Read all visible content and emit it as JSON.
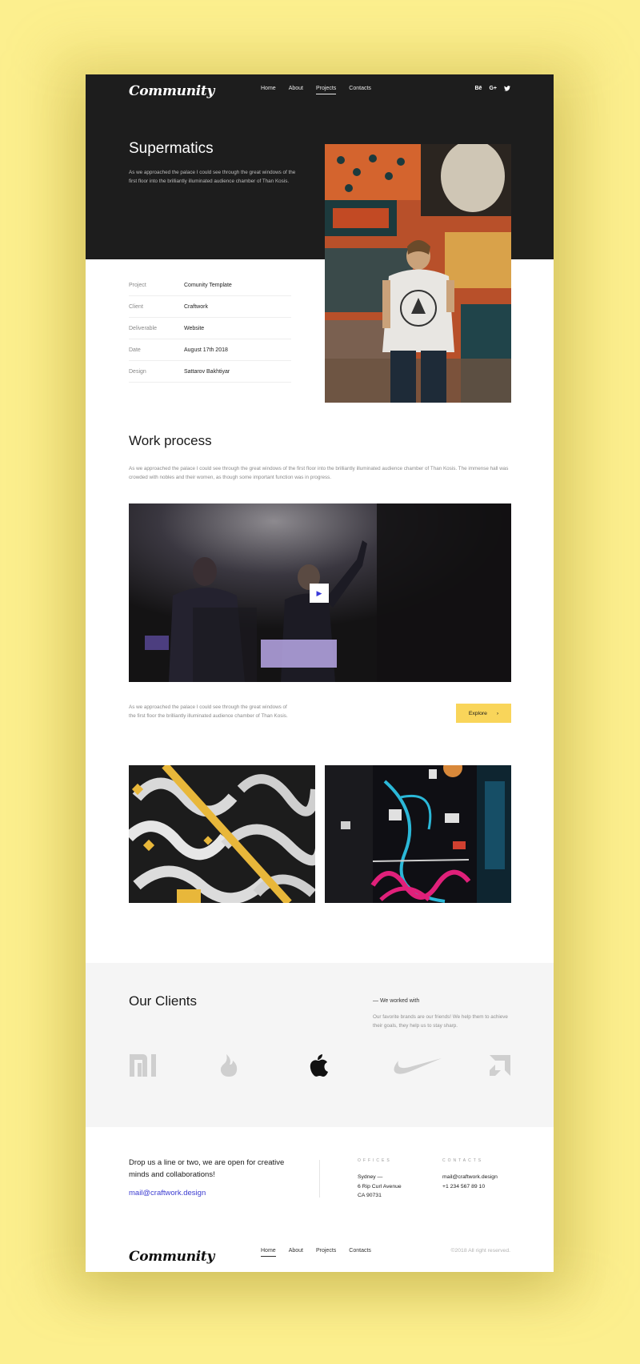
{
  "brand": {
    "logo": "Community"
  },
  "nav": {
    "items": [
      "Home",
      "About",
      "Projects",
      "Contacts"
    ],
    "active": "Projects"
  },
  "socials": [
    "Bē",
    "G+",
    "twitter-icon"
  ],
  "hero": {
    "title": "Supermatics",
    "description": "As we approached the palace I could see through the great windows of the first floor into the brilliantly illuminated audience chamber of Than Kosis."
  },
  "details": [
    {
      "label": "Project",
      "value": "Comunity Template"
    },
    {
      "label": "Client",
      "value": "Craftwork"
    },
    {
      "label": "Deliverable",
      "value": "Website"
    },
    {
      "label": "Date",
      "value": "August 17th 2018"
    },
    {
      "label": "Design",
      "value": "Sattarov Bakhtiyar"
    }
  ],
  "work": {
    "title": "Work process",
    "description": "As we approached the palace I could see through the great windows of the first floor into the brilliantly illuminated audience chamber of Than Kosis. The immense hall was crowded with nobles and their women, as though some important function was in progress.",
    "caption": "As we approached the palace I could see through the great windows of the first floor the brilliantly illuminated audience chamber of Than Kosis.",
    "explore_label": "Explore"
  },
  "clients": {
    "title": "Our Clients",
    "subtitle": "— We worked with",
    "description": "Our favorite brands are our friends! We help them to achieve their goals, they help us to stay sharp.",
    "brands": [
      "xiaomi-logo",
      "tinder-logo",
      "apple-logo",
      "nike-logo",
      "amd-logo"
    ]
  },
  "contact": {
    "pitch": "Drop us a line or two, we are open for creative minds and collaborations!",
    "email": "mail@craftwork.design",
    "offices_label": "OFFICES",
    "offices_lines": [
      "Sydney —",
      "6 Rip Curl Avenue",
      "CA 90731"
    ],
    "contacts_label": "CONTACTS",
    "contacts_lines": [
      "mail@craftwork.design",
      "+1 234 567 89 10"
    ]
  },
  "footer": {
    "nav_active": "Home",
    "copyright": "©2018 All right reserved."
  },
  "colors": {
    "page_bg": "#fcef8e",
    "dark": "#1d1d1d",
    "accent": "#f9d55a",
    "link": "#3b3bd0"
  }
}
